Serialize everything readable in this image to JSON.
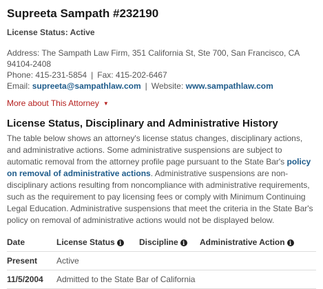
{
  "attorney": {
    "name": "Supreeta Sampath #232190",
    "license_status": "License Status: Active"
  },
  "contact": {
    "address": "Address: The Sampath Law Firm, 351 California St, Ste 700, San Francisco, CA 94104-2408",
    "phone": "Phone: 415-231-5854",
    "fax": "Fax: 415-202-6467",
    "email_label": "Email:",
    "email": "supreeta@sampathlaw.com",
    "website_label": "Website:",
    "website": "www.sampathlaw.com",
    "separator": "|"
  },
  "more_link": "More about This Attorney",
  "history": {
    "heading": "License Status, Disciplinary and Administrative History",
    "para_start": "The table below shows an attorney's license status changes, disciplinary actions, and administrative actions. Some administrative suspensions are subject to automatic removal from the attorney profile page pursuant to the State Bar's ",
    "policy_link": "policy on removal of administrative actions",
    "para_end": ". Administrative suspensions are non-disciplinary actions resulting from noncompliance with administrative requirements, such as the requirement to pay licensing fees or comply with Minimum Continuing Legal Education. Administrative suspensions that meet the criteria in the State Bar's policy on removal of administrative actions would not be displayed below."
  },
  "table": {
    "headers": [
      "Date",
      "License Status",
      "Discipline",
      "Administrative Action"
    ],
    "rows": [
      {
        "date": "Present",
        "status": "Active",
        "discipline": "",
        "action": ""
      },
      {
        "date": "11/5/2004",
        "status": "Admitted to the State Bar of California",
        "discipline": "",
        "action": ""
      }
    ]
  },
  "icons": {
    "info": "info-circle-icon",
    "caret": "caret-down-icon"
  },
  "colors": {
    "link": "#1f5c8b",
    "more_link": "#b5201f"
  }
}
